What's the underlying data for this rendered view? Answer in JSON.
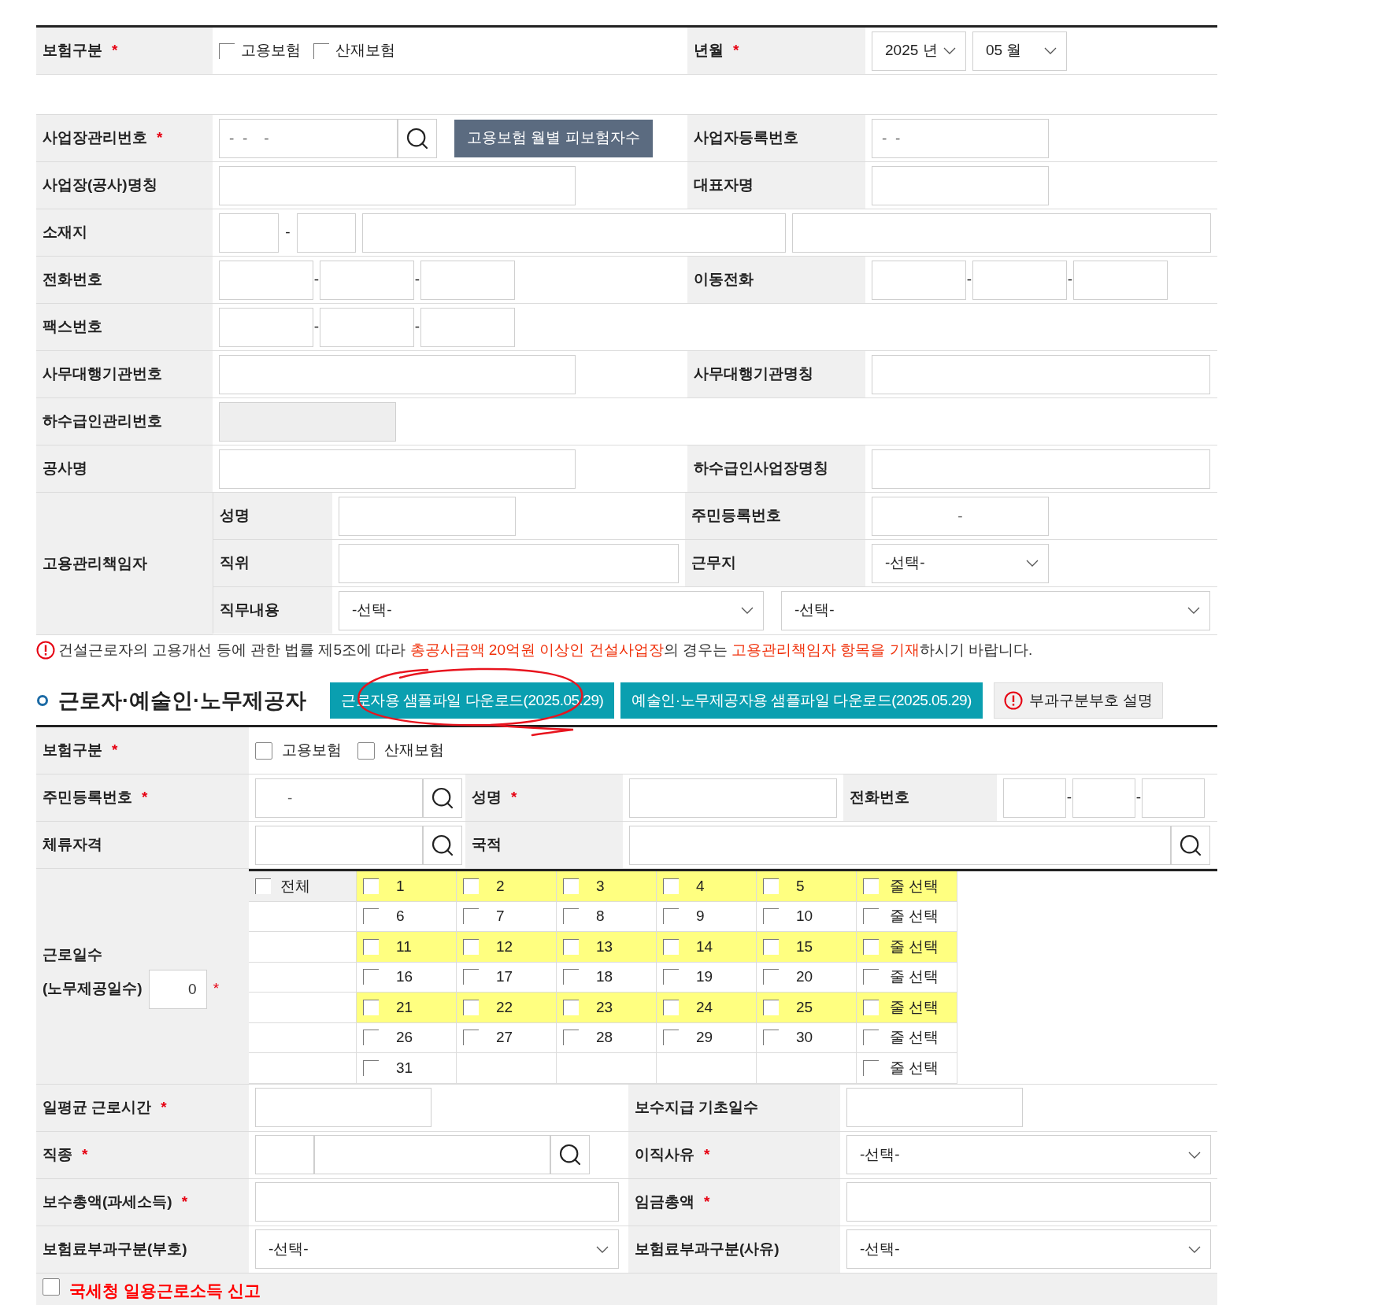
{
  "period": {
    "insurance_type": {
      "label": "보험구분",
      "mark": "*",
      "options": [
        {
          "label": "고용보험",
          "checked": false
        },
        {
          "label": "산재보험",
          "checked": false
        }
      ]
    },
    "year_month": {
      "label": "년월",
      "mark": "*",
      "year": "2025 년",
      "month": "05 월"
    }
  },
  "business": {
    "mgmt_no": {
      "label": "사업장관리번호",
      "mark": "*",
      "placeholder": "-  -    -",
      "button": "고용보험 월별 피보험자수"
    },
    "reg_no": {
      "label": "사업자등록번호",
      "placeholder": "-  -"
    },
    "name": {
      "label": "사업장(공사)명칭"
    },
    "ceo": {
      "label": "대표자명"
    },
    "address": {
      "label": "소재지",
      "separator": "-"
    },
    "phone": {
      "label": "전화번호",
      "separators": [
        "-",
        "-"
      ]
    },
    "mobile": {
      "label": "이동전화",
      "separators": [
        "-",
        "-"
      ]
    },
    "fax": {
      "label": "팩스번호",
      "separators": [
        "-",
        "-"
      ]
    },
    "agency_no": {
      "label": "사무대행기관번호"
    },
    "agency_name": {
      "label": "사무대행기관명칭"
    },
    "subcontractor_no": {
      "label": "하수급인관리번호",
      "disabled": true
    },
    "project": {
      "label": "공사명"
    },
    "subcontractor_name": {
      "label": "하수급인사업장명칭"
    },
    "manager": {
      "label": "고용관리책임자",
      "name_label": "성명",
      "rrn_label": "주민등록번호",
      "rrn_placeholder": "-",
      "position_label": "직위",
      "workplace_label": "근무지",
      "workplace_value": "-선택-",
      "duty_label": "직무내용",
      "duty_values": [
        "-선택-",
        "-선택-"
      ]
    }
  },
  "notice": [
    {
      "kind": "plain",
      "text": "건설근로자의 고용개선 등에 관한 법률 제5조에 따라 "
    },
    {
      "kind": "highlight",
      "text": "총공사금액 20억원 이상인 건설사업장"
    },
    {
      "kind": "plain",
      "text": "의 경우는 "
    },
    {
      "kind": "highlight",
      "text": "고용관리책임자 항목을 기재"
    },
    {
      "kind": "plain",
      "text": "하시기 바랍니다."
    }
  ],
  "worker": {
    "title": "근로자·예술인·노무제공자",
    "buttons": [
      {
        "label": "근로자용 샘플파일 다운로드(2025.05.29)"
      },
      {
        "label": "예술인·노무제공자용 샘플파일 다운로드(2025.05.29)"
      }
    ],
    "help_button": "부과구분부호 설명",
    "insurance_type": {
      "label": "보험구분",
      "mark": "*",
      "options": [
        {
          "label": "고용보험",
          "checked": false
        },
        {
          "label": "산재보험",
          "checked": false
        }
      ]
    },
    "rrn": {
      "label": "주민등록번호",
      "mark": "*",
      "placeholder": "-"
    },
    "name": {
      "label": "성명",
      "mark": "*"
    },
    "phone": {
      "label": "전화번호",
      "separators": [
        "-",
        "-"
      ]
    },
    "visa": {
      "label": "체류자격"
    },
    "nationality": {
      "label": "국적"
    },
    "work_days": {
      "label_lines": [
        "근로일수",
        "(노무제공일수)"
      ],
      "value": "0",
      "mark": "*",
      "all": {
        "label": "전체",
        "checked": false
      },
      "rows": [
        {
          "highlighted": true,
          "days": [
            {
              "label": "1",
              "checked": false
            },
            {
              "label": "2",
              "checked": false
            },
            {
              "label": "3",
              "checked": false
            },
            {
              "label": "4",
              "checked": false
            },
            {
              "label": "5",
              "checked": false
            }
          ],
          "row_select": {
            "label": "줄 선택",
            "checked": false
          }
        },
        {
          "highlighted": false,
          "days": [
            {
              "label": "6",
              "checked": false
            },
            {
              "label": "7",
              "checked": false
            },
            {
              "label": "8",
              "checked": false
            },
            {
              "label": "9",
              "checked": false
            },
            {
              "label": "10",
              "checked": false
            }
          ],
          "row_select": {
            "label": "줄 선택",
            "checked": false
          }
        },
        {
          "highlighted": true,
          "days": [
            {
              "label": "11",
              "checked": false
            },
            {
              "label": "12",
              "checked": false
            },
            {
              "label": "13",
              "checked": false
            },
            {
              "label": "14",
              "checked": false
            },
            {
              "label": "15",
              "checked": false
            }
          ],
          "row_select": {
            "label": "줄 선택",
            "checked": false
          }
        },
        {
          "highlighted": false,
          "days": [
            {
              "label": "16",
              "checked": false
            },
            {
              "label": "17",
              "checked": false
            },
            {
              "label": "18",
              "checked": false
            },
            {
              "label": "19",
              "checked": false
            },
            {
              "label": "20",
              "checked": false
            }
          ],
          "row_select": {
            "label": "줄 선택",
            "checked": false
          }
        },
        {
          "highlighted": true,
          "days": [
            {
              "label": "21",
              "checked": false
            },
            {
              "label": "22",
              "checked": false
            },
            {
              "label": "23",
              "checked": false
            },
            {
              "label": "24",
              "checked": false
            },
            {
              "label": "25",
              "checked": false
            }
          ],
          "row_select": {
            "label": "줄 선택",
            "checked": false
          }
        },
        {
          "highlighted": false,
          "days": [
            {
              "label": "26",
              "checked": false
            },
            {
              "label": "27",
              "checked": false
            },
            {
              "label": "28",
              "checked": false
            },
            {
              "label": "29",
              "checked": false
            },
            {
              "label": "30",
              "checked": false
            }
          ],
          "row_select": {
            "label": "줄 선택",
            "checked": false
          }
        },
        {
          "highlighted": false,
          "days": [
            {
              "label": "31",
              "checked": false
            }
          ],
          "row_select": {
            "label": "줄 선택",
            "checked": false
          }
        }
      ]
    },
    "daily_hours": {
      "label": "일평균 근로시간",
      "mark": "*"
    },
    "pay_days": {
      "label": "보수지급 기초일수"
    },
    "job": {
      "label": "직종",
      "mark": "*"
    },
    "leave_reason": {
      "label": "이직사유",
      "mark": "*",
      "value": "-선택-"
    },
    "total_pay": {
      "label": "보수총액(과세소득)",
      "mark": "*"
    },
    "total_wage": {
      "label": "임금총액",
      "mark": "*"
    },
    "premium_code": {
      "label": "보험료부과구분(부호)",
      "value": "-선택-"
    },
    "premium_reason": {
      "label": "보험료부과구분(사유)",
      "value": "-선택-"
    },
    "nts_report": {
      "label": "국세청 일용근로소득 신고",
      "checked": false
    }
  }
}
